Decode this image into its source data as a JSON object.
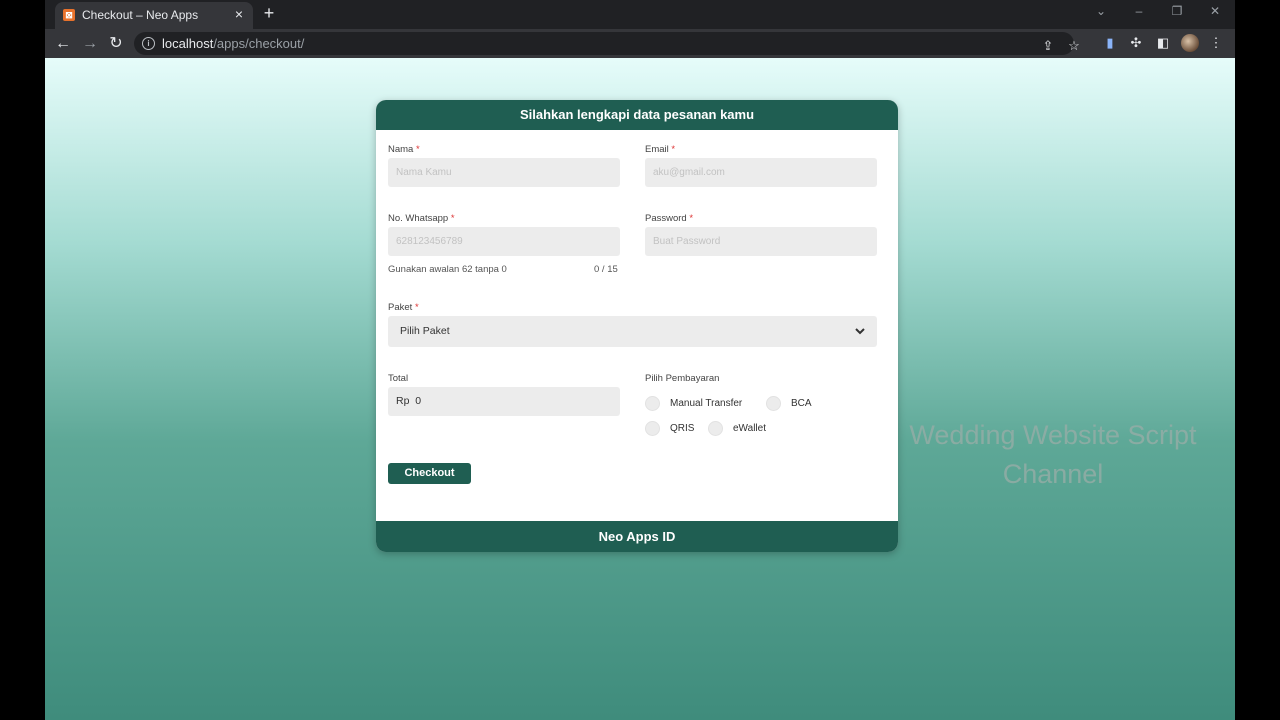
{
  "browser": {
    "tab_title": "Checkout – Neo Apps",
    "tab_close": "×",
    "new_tab": "+",
    "url_host": "localhost",
    "url_path": "/apps/checkout/"
  },
  "form": {
    "header": "Silahkan lengkapi data pesanan kamu",
    "name_label": "Nama",
    "name_placeholder": "Nama Kamu",
    "email_label": "Email",
    "email_placeholder": "aku@gmail.com",
    "whatsapp_label": "No. Whatsapp",
    "whatsapp_placeholder": "628123456789",
    "whatsapp_hint": "Gunakan awalan 62 tanpa 0",
    "whatsapp_counter": "0 / 15",
    "password_label": "Password",
    "password_placeholder": "Buat Password",
    "paket_label": "Paket",
    "paket_selected": "Pilih Paket",
    "total_label": "Total",
    "total_currency": "Rp",
    "total_value": "0",
    "payment_label": "Pilih Pembayaran",
    "payment_options": [
      "Manual Transfer",
      "BCA",
      "QRIS",
      "eWallet"
    ],
    "required_mark": "*",
    "checkout_button": "Checkout",
    "footer": "Neo Apps ID"
  },
  "watermark": {
    "line1": "Wedding Website Script",
    "line2": "Channel"
  },
  "colors": {
    "brand": "#1f5e52",
    "field_bg": "#ececec",
    "required": "#dd3333"
  }
}
